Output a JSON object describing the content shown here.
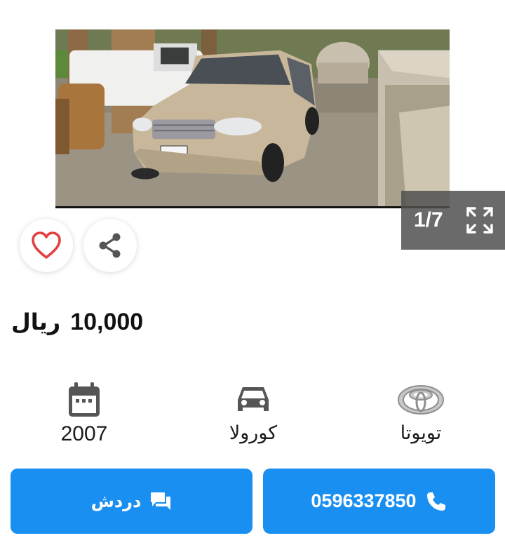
{
  "gallery": {
    "counter": "1/7",
    "icons": {
      "prev": "chevron-left-icon",
      "next": "chevron-right-icon",
      "fullscreen": "fullscreen-icon"
    }
  },
  "actions": {
    "favorite_icon": "heart-icon",
    "share_icon": "share-icon"
  },
  "listing": {
    "price_value": "10,000",
    "price_currency": "ريال"
  },
  "specs": {
    "year": "2007",
    "model": "كورولا",
    "make": "تويوتا",
    "icons": {
      "year": "calendar-icon",
      "model": "car-icon",
      "make": "toyota-logo-icon"
    }
  },
  "contact": {
    "phone": "0596337850",
    "chat_label": "دردش",
    "icons": {
      "phone": "phone-icon",
      "chat": "chat-icon"
    }
  },
  "colors": {
    "primary": "#1a8ff2",
    "heart": "#e0413e",
    "icon_gray": "#555555",
    "overlay": "#505050"
  }
}
